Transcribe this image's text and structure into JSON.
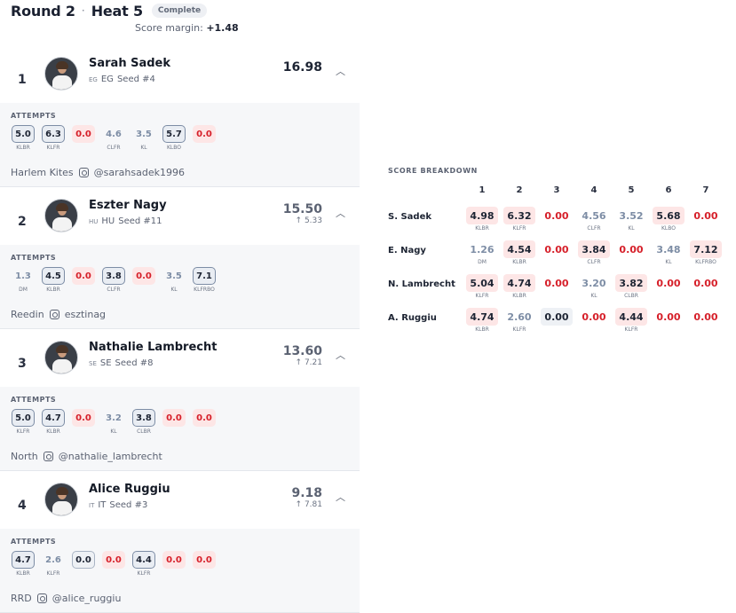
{
  "header": {
    "round": "Round 2",
    "separator": "·",
    "heat": "Heat 5",
    "status": "Complete"
  },
  "score_margin": {
    "label": "Score margin:",
    "value": "+1.48"
  },
  "attempts_label": "ATTEMPTS",
  "riders": [
    {
      "rank": "1",
      "name": "Sarah Sadek",
      "country_code": "EG",
      "country": "EG",
      "seed": "Seed #4",
      "total": "16.98",
      "diff": "",
      "total_color": "#1d2433",
      "club": "Harlem Kites",
      "instagram": "@sarahsadek1996",
      "attempts": [
        {
          "score": "5.0",
          "trick": "KLBR",
          "style": "best"
        },
        {
          "score": "6.3",
          "trick": "KLFR",
          "style": "best"
        },
        {
          "score": "0.0",
          "trick": "",
          "style": "zero"
        },
        {
          "score": "4.6",
          "trick": "CLFR",
          "style": "plain"
        },
        {
          "score": "3.5",
          "trick": "KL",
          "style": "plain"
        },
        {
          "score": "5.7",
          "trick": "KLBO",
          "style": "best"
        },
        {
          "score": "0.0",
          "trick": "",
          "style": "zero"
        }
      ]
    },
    {
      "rank": "2",
      "name": "Eszter Nagy",
      "country_code": "HU",
      "country": "HU",
      "seed": "Seed #11",
      "total": "15.50",
      "diff": "↑ 5.33",
      "total_color": "#5b6272",
      "club": "Reedin",
      "instagram": "esztinag",
      "attempts": [
        {
          "score": "1.3",
          "trick": "DM",
          "style": "plain"
        },
        {
          "score": "4.5",
          "trick": "KLBR",
          "style": "best"
        },
        {
          "score": "0.0",
          "trick": "",
          "style": "zero"
        },
        {
          "score": "3.8",
          "trick": "CLFR",
          "style": "best"
        },
        {
          "score": "0.0",
          "trick": "",
          "style": "zero"
        },
        {
          "score": "3.5",
          "trick": "KL",
          "style": "plain"
        },
        {
          "score": "7.1",
          "trick": "KLFRBO",
          "style": "best"
        }
      ]
    },
    {
      "rank": "3",
      "name": "Nathalie Lambrecht",
      "country_code": "SE",
      "country": "SE",
      "seed": "Seed #8",
      "total": "13.60",
      "diff": "↑ 7.21",
      "total_color": "#5b6272",
      "club": "North",
      "instagram": "@nathalie_lambrecht",
      "attempts": [
        {
          "score": "5.0",
          "trick": "KLFR",
          "style": "best"
        },
        {
          "score": "4.7",
          "trick": "KLBR",
          "style": "best"
        },
        {
          "score": "0.0",
          "trick": "",
          "style": "zero"
        },
        {
          "score": "3.2",
          "trick": "KL",
          "style": "plain"
        },
        {
          "score": "3.8",
          "trick": "CLBR",
          "style": "best"
        },
        {
          "score": "0.0",
          "trick": "",
          "style": "zero"
        },
        {
          "score": "0.0",
          "trick": "",
          "style": "zero"
        }
      ]
    },
    {
      "rank": "4",
      "name": "Alice Ruggiu",
      "country_code": "IT",
      "country": "IT",
      "seed": "Seed #3",
      "total": "9.18",
      "diff": "↑ 7.81",
      "total_color": "#5b6272",
      "club": "RRD",
      "instagram": "@alice_ruggiu",
      "attempts": [
        {
          "score": "4.7",
          "trick": "KLBR",
          "style": "best"
        },
        {
          "score": "2.6",
          "trick": "KLFR",
          "style": "plain"
        },
        {
          "score": "0.0",
          "trick": "",
          "style": "zerob"
        },
        {
          "score": "0.0",
          "trick": "",
          "style": "zero"
        },
        {
          "score": "4.4",
          "trick": "KLFR",
          "style": "best"
        },
        {
          "score": "0.0",
          "trick": "",
          "style": "zero"
        },
        {
          "score": "0.0",
          "trick": "",
          "style": "zero"
        }
      ]
    }
  ],
  "breakdown": {
    "title": "SCORE BREAKDOWN",
    "columns": [
      "1",
      "2",
      "3",
      "4",
      "5",
      "6",
      "7"
    ],
    "rows": [
      {
        "name": "S. Sadek",
        "cells": [
          {
            "v": "4.98",
            "t": "KLBR",
            "s": "hi"
          },
          {
            "v": "6.32",
            "t": "KLFR",
            "s": "hi"
          },
          {
            "v": "0.00",
            "t": "",
            "s": "z"
          },
          {
            "v": "4.56",
            "t": "CLFR",
            "s": "lo"
          },
          {
            "v": "3.52",
            "t": "KL",
            "s": "lo"
          },
          {
            "v": "5.68",
            "t": "KLBO",
            "s": "hi"
          },
          {
            "v": "0.00",
            "t": "",
            "s": "z"
          }
        ]
      },
      {
        "name": "E. Nagy",
        "cells": [
          {
            "v": "1.26",
            "t": "DM",
            "s": "lo"
          },
          {
            "v": "4.54",
            "t": "KLBR",
            "s": "hi"
          },
          {
            "v": "0.00",
            "t": "",
            "s": "z"
          },
          {
            "v": "3.84",
            "t": "CLFR",
            "s": "hi"
          },
          {
            "v": "0.00",
            "t": "",
            "s": "z"
          },
          {
            "v": "3.48",
            "t": "KL",
            "s": "lo"
          },
          {
            "v": "7.12",
            "t": "KLFRBO",
            "s": "hi"
          }
        ]
      },
      {
        "name": "N. Lambrecht",
        "cells": [
          {
            "v": "5.04",
            "t": "KLFR",
            "s": "hi"
          },
          {
            "v": "4.74",
            "t": "KLBR",
            "s": "hi"
          },
          {
            "v": "0.00",
            "t": "",
            "s": "z"
          },
          {
            "v": "3.20",
            "t": "KL",
            "s": "lo"
          },
          {
            "v": "3.82",
            "t": "CLBR",
            "s": "hi"
          },
          {
            "v": "0.00",
            "t": "",
            "s": "z"
          },
          {
            "v": "0.00",
            "t": "",
            "s": "z"
          }
        ]
      },
      {
        "name": "A. Ruggiu",
        "cells": [
          {
            "v": "4.74",
            "t": "KLBR",
            "s": "hi"
          },
          {
            "v": "2.60",
            "t": "KLFR",
            "s": "lo"
          },
          {
            "v": "0.00",
            "t": "",
            "s": "zb"
          },
          {
            "v": "0.00",
            "t": "",
            "s": "z"
          },
          {
            "v": "4.44",
            "t": "KLFR",
            "s": "hi"
          },
          {
            "v": "0.00",
            "t": "",
            "s": "z"
          },
          {
            "v": "0.00",
            "t": "",
            "s": "z"
          }
        ]
      }
    ]
  }
}
